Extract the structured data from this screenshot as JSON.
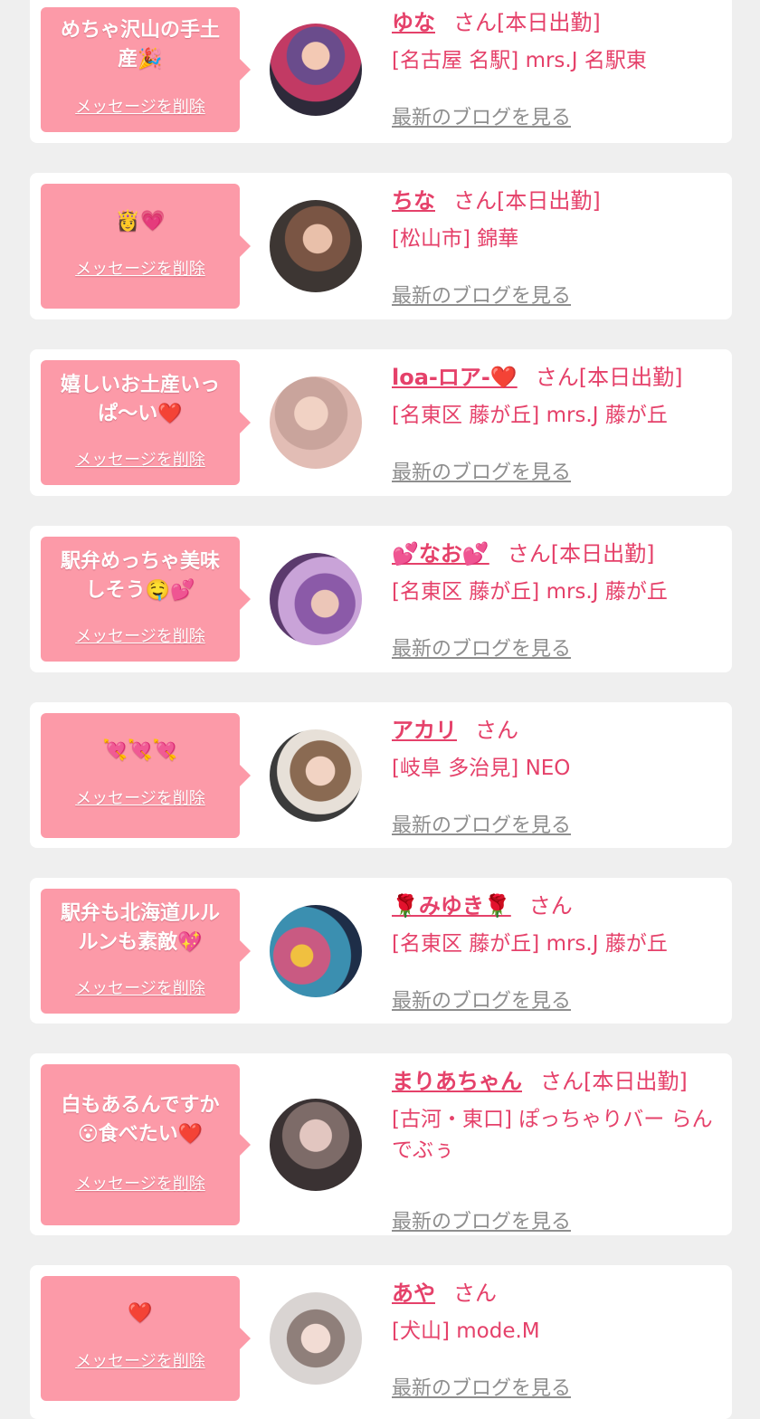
{
  "delete_label": "メッセージを削除",
  "blog_label": "最新のブログを見る",
  "colors": {
    "bubble": "#fc9aa8",
    "accent": "#e5416a",
    "link_gray": "#8e8e8e",
    "background": "#efefef"
  },
  "items": [
    {
      "message": "めちゃ沢山の手土\n産🎉",
      "name": "ゆな",
      "suffix": "さん[本日出勤]",
      "shop": "[名古屋 名駅] mrs.J 名駅東"
    },
    {
      "message": "👸💗",
      "name": "ちな",
      "suffix": "さん[本日出勤]",
      "shop": "[松山市] 錦華"
    },
    {
      "message": "嬉しいお土産いっ\nぱ〜い❤️",
      "name": "loa-ロア-❤️",
      "suffix": "さん[本日出勤]",
      "shop": "[名東区 藤が丘] mrs.J 藤が丘"
    },
    {
      "message": "駅弁めっちゃ美味\nしそう🤤💕",
      "name": "💕なお💕",
      "suffix": "さん[本日出勤]",
      "shop": "[名東区 藤が丘] mrs.J 藤が丘"
    },
    {
      "message": "💘💘💘",
      "name": "アカリ",
      "suffix": "さん",
      "shop": "[岐阜 多治見] NEO"
    },
    {
      "message": "駅弁も北海道ルル\nルンも素敵💖",
      "name": "🌹みゆき🌹",
      "suffix": "さん",
      "shop": "[名東区 藤が丘] mrs.J 藤が丘"
    },
    {
      "message": "白もあるんですか\n😮食べたい❤️",
      "name": "まりあちゃん",
      "suffix": "さん[本日出勤]",
      "shop": "[古河・東口] ぽっちゃりバー らんでぶぅ"
    },
    {
      "message": "❤️",
      "name": "あや",
      "suffix": "さん",
      "shop": "[犬山] mode.M"
    }
  ]
}
